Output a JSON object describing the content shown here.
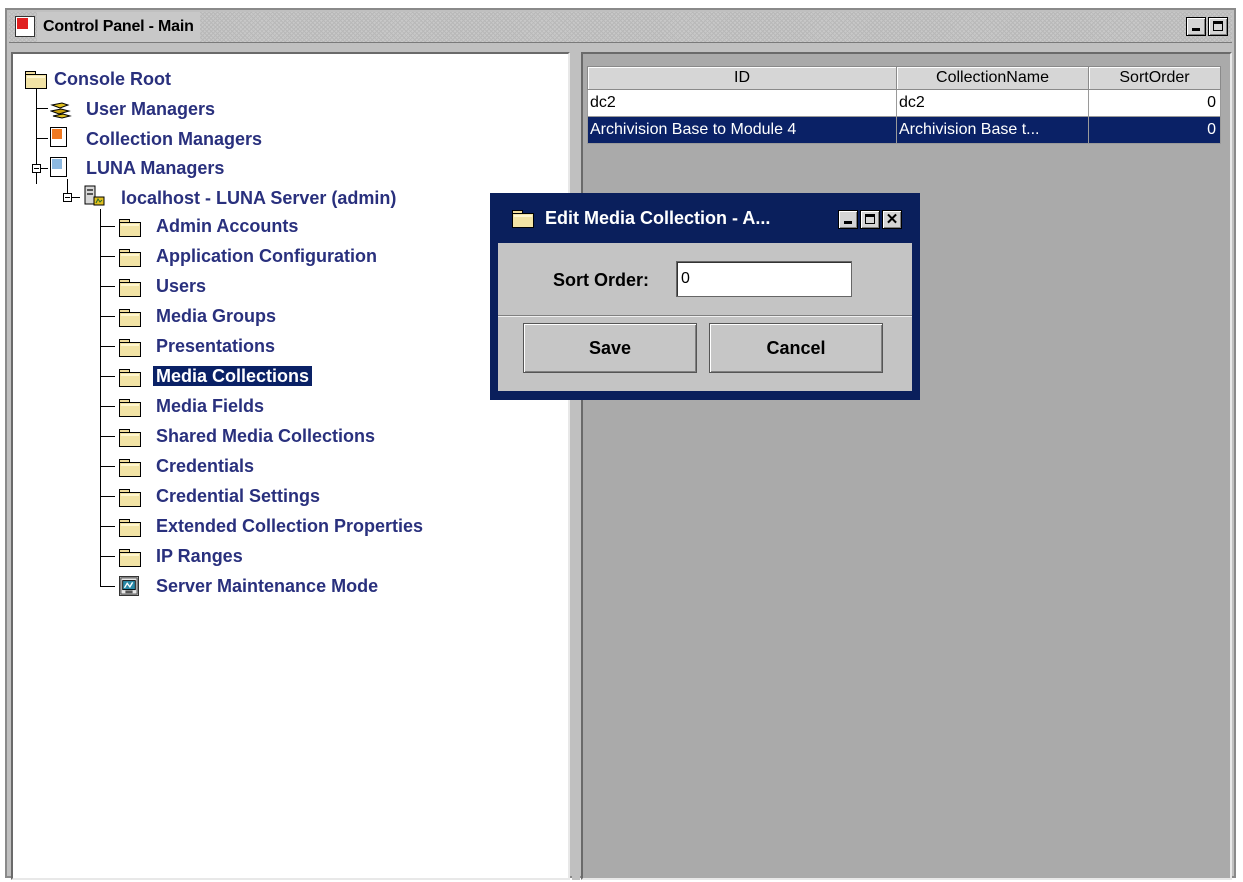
{
  "window": {
    "title": "Control Panel - Main"
  },
  "tree": {
    "root": "Console Root",
    "user_managers": "User Managers",
    "collection_managers": "Collection Managers",
    "luna_managers": "LUNA Managers",
    "server": "localhost - LUNA Server (admin)",
    "items": [
      {
        "label": "Admin Accounts",
        "icon": "folder-icon"
      },
      {
        "label": "Application Configuration",
        "icon": "folder-icon"
      },
      {
        "label": "Users",
        "icon": "folder-icon"
      },
      {
        "label": "Media Groups",
        "icon": "folder-icon"
      },
      {
        "label": "Presentations",
        "icon": "folder-icon"
      },
      {
        "label": "Media Collections",
        "icon": "folder-icon",
        "selected": true
      },
      {
        "label": "Media Fields",
        "icon": "folder-icon"
      },
      {
        "label": "Shared Media Collections",
        "icon": "folder-icon"
      },
      {
        "label": "Credentials",
        "icon": "folder-icon"
      },
      {
        "label": "Credential Settings",
        "icon": "folder-icon"
      },
      {
        "label": "Extended Collection Properties",
        "icon": "folder-icon"
      },
      {
        "label": "IP Ranges",
        "icon": "folder-icon"
      },
      {
        "label": "Server Maintenance Mode",
        "icon": "maintenance-icon"
      }
    ]
  },
  "table": {
    "columns": [
      "ID",
      "CollectionName",
      "SortOrder"
    ],
    "rows": [
      {
        "id": "dc2",
        "name": "dc2",
        "sort": "0",
        "selected": false
      },
      {
        "id": "Archivision Base to Module 4",
        "name": "Archivision Base t...",
        "sort": "0",
        "selected": true
      }
    ]
  },
  "dialog": {
    "title": "Edit Media Collection - A...",
    "sort_label": "Sort Order:",
    "sort_value": "0",
    "save_label": "Save",
    "cancel_label": "Cancel"
  },
  "colors": {
    "selection": "#0a2166",
    "tree_text": "#29307d",
    "pane_gray": "#aaaaaa",
    "dialog_frame": "#0a1f5c"
  }
}
